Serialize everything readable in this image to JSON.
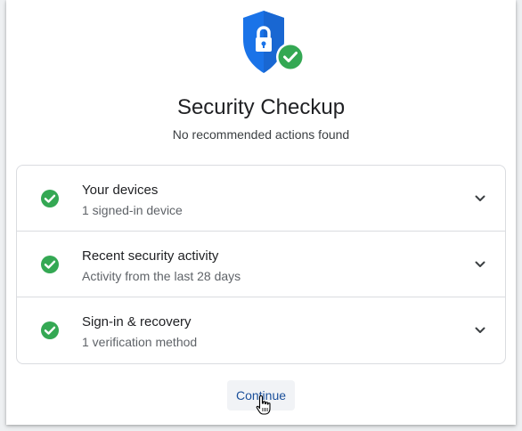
{
  "header": {
    "icon": "shield-lock-check-icon",
    "title": "Security Checkup",
    "subtitle": "No recommended actions found"
  },
  "items": [
    {
      "title": "Your devices",
      "subtitle": "1 signed-in device",
      "status_icon": "check-circle-icon",
      "expand_icon": "chevron-down-icon"
    },
    {
      "title": "Recent security activity",
      "subtitle": "Activity from the last 28 days",
      "status_icon": "check-circle-icon",
      "expand_icon": "chevron-down-icon"
    },
    {
      "title": "Sign-in & recovery",
      "subtitle": "1 verification method",
      "status_icon": "check-circle-icon",
      "expand_icon": "chevron-down-icon"
    }
  ],
  "actions": {
    "continue_label": "Continue"
  },
  "colors": {
    "shield_blue": "#1a73e8",
    "check_green": "#34a853",
    "link_blue": "#1a4f9a"
  }
}
